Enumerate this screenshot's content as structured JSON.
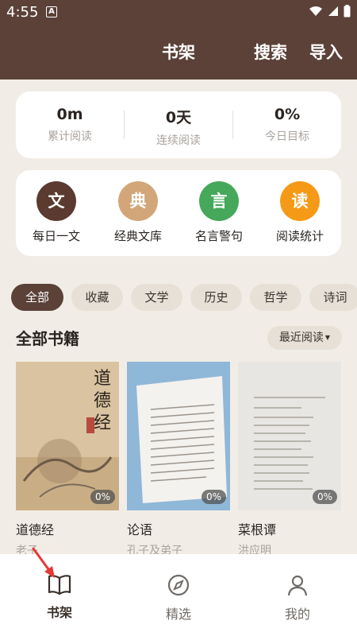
{
  "status_bar": {
    "time": "4:55",
    "notification_letter": "A"
  },
  "header": {
    "title": "书架",
    "search": "搜索",
    "import": "导入"
  },
  "stats": [
    {
      "value": "0m",
      "label": "累计阅读"
    },
    {
      "value": "0天",
      "label": "连续阅读"
    },
    {
      "value": "0%",
      "label": "今日目标"
    }
  ],
  "quick_entries": [
    {
      "glyph": "文",
      "label": "每日一文",
      "color": "#5b3a30"
    },
    {
      "glyph": "典",
      "label": "经典文库",
      "color": "#d2a679"
    },
    {
      "glyph": "言",
      "label": "名言警句",
      "color": "#45a85a"
    },
    {
      "glyph": "读",
      "label": "阅读统计",
      "color": "#f59a16"
    }
  ],
  "categories": [
    "全部",
    "收藏",
    "文学",
    "历史",
    "哲学",
    "诗词"
  ],
  "section": {
    "title": "全部书籍",
    "sort_label": "最近阅读"
  },
  "books": [
    {
      "title": "道德经",
      "author": "老子",
      "progress": "0%",
      "cover_text": "道德经"
    },
    {
      "title": "论语",
      "author": "孔子及弟子",
      "progress": "0%"
    },
    {
      "title": "菜根谭",
      "author": "洪应明",
      "progress": "0%"
    }
  ],
  "nav": {
    "shelf": "书架",
    "featured": "精选",
    "mine": "我的"
  },
  "colors": {
    "brand": "#5b4138",
    "background": "#f1ede6"
  }
}
